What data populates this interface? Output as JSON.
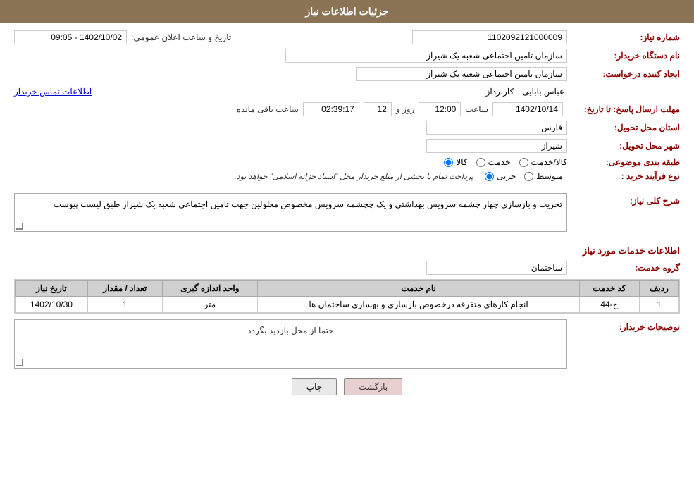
{
  "header": {
    "title": "جزئیات اطلاعات نیاز"
  },
  "fields": {
    "naz_number_label": "شماره نیاز:",
    "naz_number_value": "1102092121000009",
    "org_name_label": "نام دستگاه خریدار:",
    "org_name_value": "سازمان تامین اجتماعی شعبه یک شیراز",
    "creator_label": "ایجاد کننده درخواست:",
    "creator_value": "سازمان تامین اجتماعی شعبه یک شیراز",
    "creator_name": "عباس  بابایی",
    "creator_role": "کاربرداز",
    "contact_link": "اطلاعات تماس خریدار",
    "deadline_label": "مهلت ارسال پاسخ: تا تاریخ:",
    "deadline_date": "1402/10/14",
    "deadline_time_label": "ساعت",
    "deadline_time": "12:00",
    "deadline_day_label": "روز و",
    "deadline_days": "12",
    "deadline_remaining_label": "ساعت باقی مانده",
    "deadline_remaining": "02:39:17",
    "province_label": "استان محل تحویل:",
    "province_value": "فارس",
    "city_label": "شهر محل تحویل:",
    "city_value": "شیراز",
    "announce_label": "تاریخ و ساعت اعلان عمومی:",
    "announce_value": "1402/10/02 - 09:05",
    "category_label": "طبقه بندی موضوعی:",
    "category_kala": "کالا",
    "category_khedmat": "خدمت",
    "category_kala_khedmat": "کالا/خدمت",
    "purchase_type_label": "نوع فرآیند خرید :",
    "purchase_jozvi": "جزیی",
    "purchase_motavaset": "متوسط",
    "purchase_note": "پرداخت تمام یا بخشی از مبلغ خریدار محل \"اسناد خزانه اسلامی\" خواهد بود.",
    "description_section_label": "شرح کلی نیاز:",
    "description_text": "تخریب و بازسازی چهار چشمه سرویس بهداشتی و یک چچشمه سرویس مخصوص معلولین جهت تامین اجتماعی شعبه یک شیراز طبق لیست پیوست",
    "services_section_label": "اطلاعات خدمات مورد نیاز",
    "service_group_label": "گروه خدمت:",
    "service_group_value": "ساختمان",
    "table": {
      "headers": [
        "ردیف",
        "کد خدمت",
        "نام خدمت",
        "واحد اندازه گیری",
        "تعداد / مقدار",
        "تاریخ نیاز"
      ],
      "rows": [
        {
          "row": "1",
          "code": "ج-44",
          "name": "انجام کارهای متفرقه درخصوص بازسازی و بهسازی ساختمان ها",
          "unit": "متر",
          "quantity": "1",
          "date": "1402/10/30"
        }
      ]
    },
    "buyer_notes_label": "توصیحات خریدار:",
    "buyer_notes_text": "حتما از محل بازدید بگردد"
  },
  "buttons": {
    "print": "چاپ",
    "back": "بازگشت"
  }
}
